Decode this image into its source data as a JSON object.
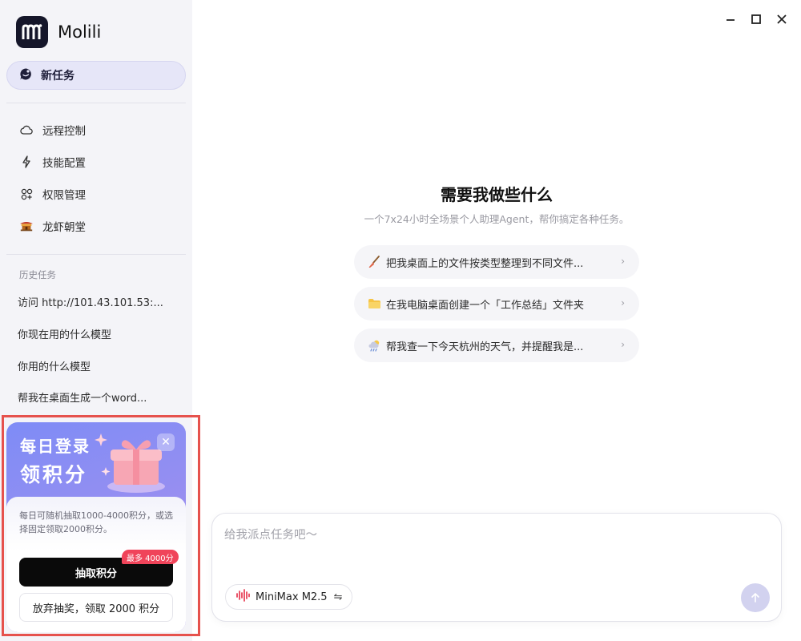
{
  "app": {
    "name": "Molili"
  },
  "sidebar": {
    "new_task": "新任务",
    "nav": [
      {
        "label": "远程控制",
        "icon": "cloud-icon"
      },
      {
        "label": "技能配置",
        "icon": "lightning-icon"
      },
      {
        "label": "权限管理",
        "icon": "grid-icon"
      },
      {
        "label": "龙虾朝堂",
        "icon": "palace-icon"
      }
    ],
    "history_title": "历史任务",
    "history": [
      "访问 http://101.43.101.53:...",
      "你现在用的什么模型",
      "你用的什么模型",
      "帮我在桌面生成一个word..."
    ]
  },
  "promo": {
    "title_line1": "每日登录",
    "title_line2": "领积分",
    "close": "✕",
    "description": "每日可随机抽取1000-4000积分，或选择固定领取2000积分。",
    "draw_button": "抽取积分",
    "max_badge": "最多 4000分",
    "giveup_button": "放弃抽奖，领取 2000 积分"
  },
  "main": {
    "title": "需要我做些什么",
    "subtitle": "一个7x24小时全场景个人助理Agent，帮你搞定各种任务。",
    "suggestions": [
      {
        "label": "把我桌面上的文件按类型整理到不同文件...",
        "icon": "broom-icon"
      },
      {
        "label": "在我电脑桌面创建一个「工作总结」文件夹",
        "icon": "folder-icon"
      },
      {
        "label": "帮我查一下今天杭州的天气，并提醒我是...",
        "icon": "weather-icon"
      }
    ],
    "chevron": "›"
  },
  "composer": {
    "placeholder": "给我派点任务吧～",
    "model": "MiniMax M2.5",
    "switch_glyph": "⇋"
  },
  "colors": {
    "accent": "#7e8cf6",
    "sidebar_bg": "#f4f4f8",
    "highlight_outline": "#e6524d",
    "badge": "#f0445a"
  }
}
